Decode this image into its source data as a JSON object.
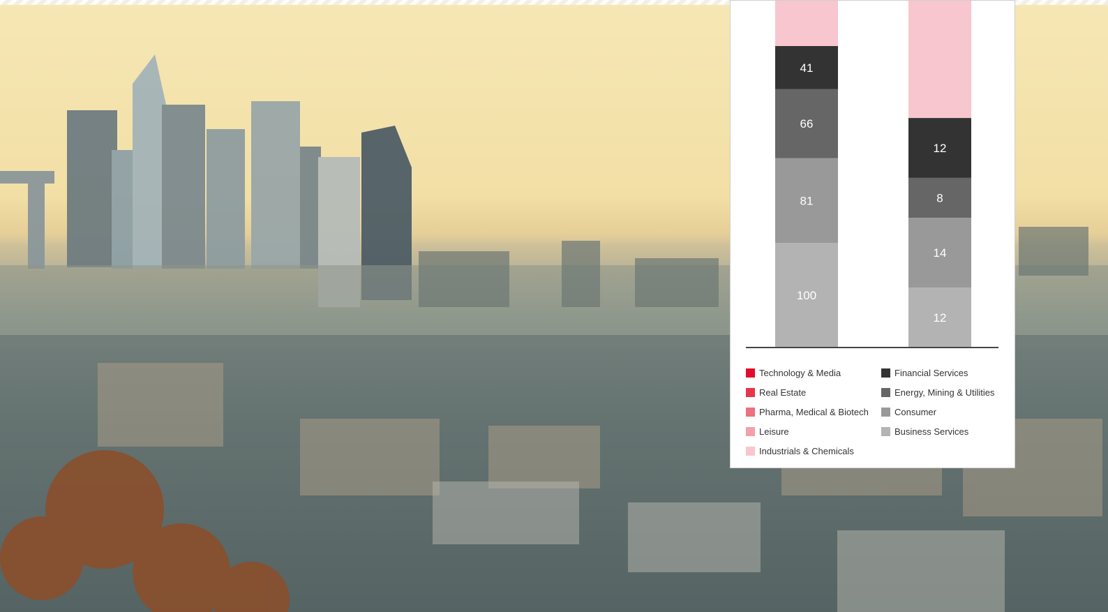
{
  "chart_data": {
    "type": "bar",
    "stacked": true,
    "orientation": "vertical",
    "title": "",
    "xlabel": "",
    "ylabel": "",
    "categories": [
      "",
      ""
    ],
    "series": [
      {
        "name": "Business Services",
        "color": "#b3b3b3",
        "values": [
          100,
          12
        ]
      },
      {
        "name": "Consumer",
        "color": "#999999",
        "values": [
          81,
          14
        ]
      },
      {
        "name": "Energy, Mining & Utilities",
        "color": "#666666",
        "values": [
          66,
          8
        ]
      },
      {
        "name": "Financial Services",
        "color": "#333333",
        "values": [
          41,
          12
        ]
      },
      {
        "name": "Industrials & Chemicals",
        "color": "#f8c6ce",
        "values": [
          null,
          null
        ]
      },
      {
        "name": "Leisure",
        "color": "#f3a0ab",
        "values": [
          null,
          null
        ]
      },
      {
        "name": "Pharma, Medical & Biotech",
        "color": "#ee6f7e",
        "values": [
          null,
          null
        ]
      },
      {
        "name": "Real Estate",
        "color": "#e8354b",
        "values": [
          null,
          null
        ]
      },
      {
        "name": "Technology & Media",
        "color": "#e30d2b",
        "values": [
          null,
          null
        ]
      }
    ],
    "visible_labels": [
      [
        "100",
        "81",
        "66",
        "41"
      ],
      [
        "12",
        "14",
        "8",
        "12"
      ]
    ],
    "legend_position": "bottom",
    "grid": false
  },
  "legend": {
    "left": [
      {
        "label": "Technology & Media",
        "color": "#e30d2b"
      },
      {
        "label": "Real Estate",
        "color": "#e8354b"
      },
      {
        "label": "Pharma, Medical & Biotech",
        "color": "#ee6f7e"
      },
      {
        "label": "Leisure",
        "color": "#f3a0ab"
      },
      {
        "label": "Industrials & Chemicals",
        "color": "#f8c6ce"
      }
    ],
    "right": [
      {
        "label": "Financial Services",
        "color": "#333333"
      },
      {
        "label": "Energy, Mining & Utilities",
        "color": "#666666"
      },
      {
        "label": "Consumer",
        "color": "#999999"
      },
      {
        "label": "Business Services",
        "color": "#b3b3b3"
      }
    ]
  }
}
